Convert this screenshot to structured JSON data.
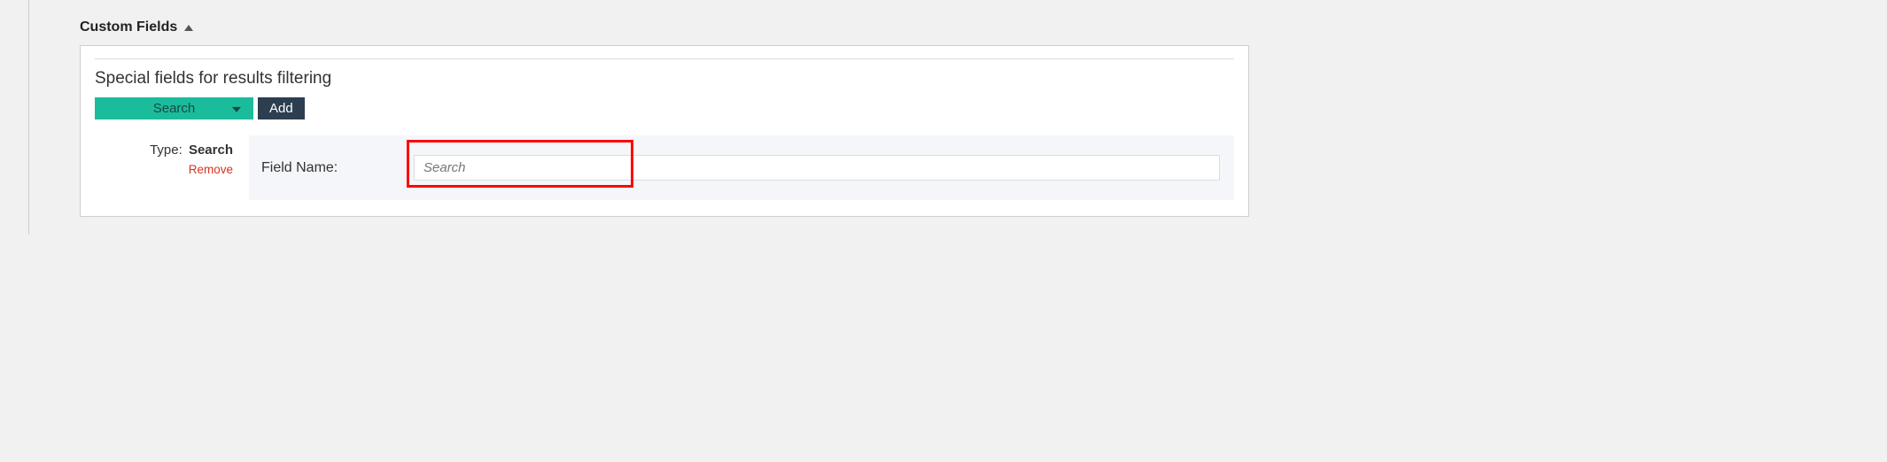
{
  "section": {
    "title": "Custom Fields"
  },
  "panel": {
    "subtitle": "Special fields for results filtering",
    "select_value": "Search",
    "add_label": "Add"
  },
  "field": {
    "type_key": "Type:",
    "type_value": "Search",
    "remove_label": "Remove",
    "name_label": "Field Name:",
    "input_placeholder": "Search"
  }
}
